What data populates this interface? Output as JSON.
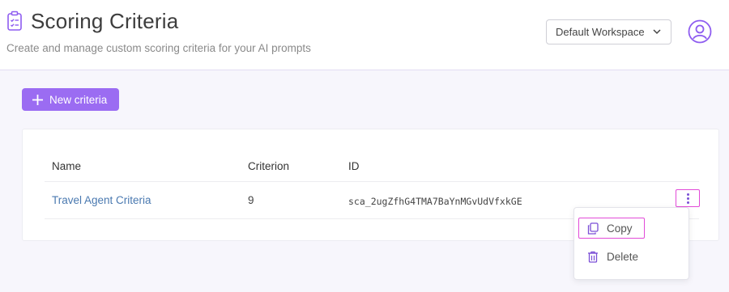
{
  "header": {
    "title": "Scoring Criteria",
    "subtitle": "Create and manage custom scoring criteria for your AI prompts",
    "title_icon": "clipboard-list-icon",
    "workspace_selected": "Default Workspace",
    "avatar_icon": "user-circle-icon"
  },
  "actions": {
    "new_label": "New criteria",
    "new_icon": "plus-icon"
  },
  "table": {
    "columns": [
      "Name",
      "Criterion",
      "ID"
    ],
    "rows": [
      {
        "name": "Travel Agent Criteria",
        "criterion": "9",
        "id": "sca_2ugZfhG4TMA7BaYnMGvUdVfxkGE"
      }
    ]
  },
  "row_menu": {
    "items": [
      {
        "label": "Copy",
        "icon": "copy-icon"
      },
      {
        "label": "Delete",
        "icon": "trash-icon"
      }
    ]
  },
  "colors": {
    "accent": "#9b6cf2",
    "link": "#4a79b0",
    "highlight": "#e24bd8"
  }
}
